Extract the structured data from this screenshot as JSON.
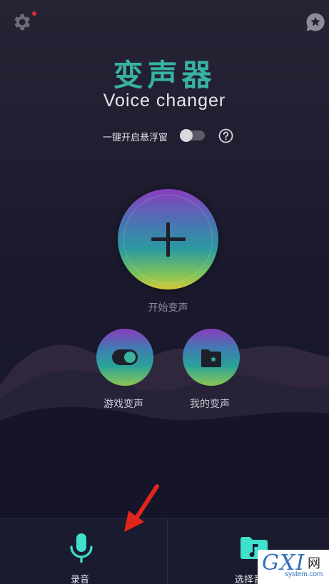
{
  "header": {
    "settings_icon": "gear-icon",
    "favorite_icon": "star-bubble-icon"
  },
  "app": {
    "title": "变声器",
    "subtitle": "Voice changer"
  },
  "floating_window": {
    "label": "一键开启悬浮窗",
    "enabled": false,
    "help_icon": "question-circle-icon"
  },
  "main_action": {
    "label": "开始变声",
    "icon": "plus-icon"
  },
  "shortcuts": [
    {
      "label": "游戏变声",
      "icon": "toggle-icon"
    },
    {
      "label": "我的变声",
      "icon": "star-folder-icon"
    }
  ],
  "bottom_bar": {
    "record_label": "录音",
    "record_icon": "microphone-icon",
    "choose_label": "选择音",
    "choose_icon": "music-folder-icon"
  },
  "watermark": {
    "brand": "GXI",
    "net": "网",
    "site": "system.com"
  },
  "colors": {
    "accent": "#38b3a2",
    "arrow": "#e0251b",
    "notification_dot": "#d8313b"
  }
}
